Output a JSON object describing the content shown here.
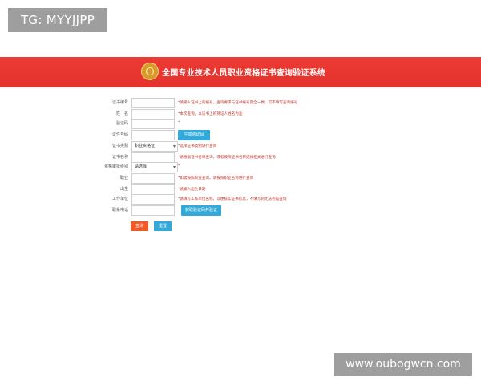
{
  "corner_badge": {
    "text": "TG: MYYJJPP"
  },
  "header": {
    "title": "全国专业技术人员职业资格证书查询验证系统",
    "logo_icon": "emblem-seal-icon",
    "background_color": "#e4312b"
  },
  "form": {
    "fields": [
      {
        "label": "证书编号",
        "value": "",
        "hint": "*请输入证书上的编号，查询要求与证书编号完全一致，可不填写查询编号"
      },
      {
        "label": "姓　名",
        "value": "",
        "hint": "*本次查询，以证书上的持证人姓名为准"
      },
      {
        "label": "验证码",
        "value": "",
        "hint": "*"
      },
      {
        "label": "证件号码",
        "value": "",
        "hint": ""
      },
      {
        "label": "证书类别",
        "selected": "职业资格证",
        "hint": "*选择证书类别进行查询"
      },
      {
        "label": "证书名称",
        "value": "",
        "hint": "*请根据证书名称查询，或者按照证书名称选择相关进行查询"
      },
      {
        "label": "资格审批级别",
        "selected": "请选择",
        "hint": "*"
      },
      {
        "label": "职业",
        "value": "",
        "hint": "*如需按照职业查询，请按照职业名称进行查询"
      },
      {
        "label": "出生",
        "value": "",
        "hint": "*请输入出生日期"
      },
      {
        "label": "工作单位",
        "value": "",
        "hint": "*请填写工作单位名称，以便核实证书信息，不填写则无法完成查询"
      },
      {
        "label": "联系电话",
        "value": "",
        "hint": ""
      }
    ],
    "generate_button": "生成验证码",
    "verify_button": "获取验证码并验证"
  },
  "actions": {
    "submit": "查询",
    "reset": "重置"
  },
  "watermark": {
    "text": "www.oubogwcn.com"
  }
}
